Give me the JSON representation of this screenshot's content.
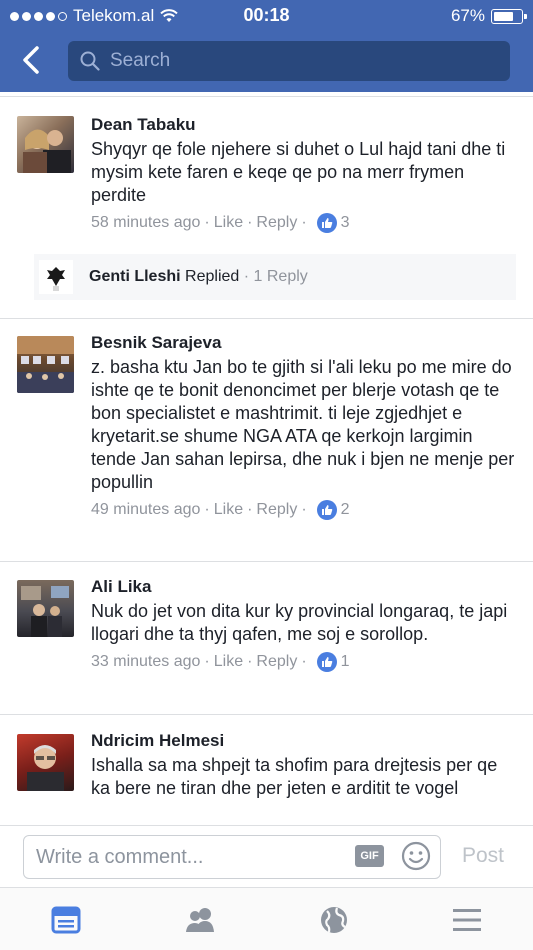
{
  "status_bar": {
    "carrier": "Telekom.al",
    "time": "00:18",
    "battery": "67%"
  },
  "header": {
    "search_placeholder": "Search"
  },
  "comments": [
    {
      "name": "Dean Tabaku",
      "text": "Shyqyr qe fole njehere si duhet o Lul hajd tani dhe ti mysim kete faren e keqe qe po na merr frymen perdite",
      "time": "58 minutes ago",
      "like": "Like",
      "reply": "Reply",
      "likes": "3"
    },
    {
      "name": "Besnik Sarajeva",
      "text": "z. basha ktu Jan bo te gjith si l'ali leku po me mire do ishte qe te bonit denoncimet per blerje votash qe te bon specialistet e mashtrimit. ti leje zgjedhjet e kryetarit.se shume NGA ATA qe kerkojn largimin tende Jan sahan lepirsa, dhe nuk i bjen ne menje per popullin",
      "time": "49 minutes ago",
      "like": "Like",
      "reply": "Reply",
      "likes": "2"
    },
    {
      "name": "Ali Lika",
      "text": "Nuk do jet von dita kur ky provincial longaraq, te japi llogari dhe ta thyj qafen, me soj e sorollop.",
      "time": "33 minutes ago",
      "like": "Like",
      "reply": "Reply",
      "likes": "1"
    },
    {
      "name": "Ndricim Helmesi",
      "text": "Ishalla sa ma shpejt ta shofim  para drejtesis per qe ka bere ne tiran dhe per jeten e arditit te vogel"
    }
  ],
  "reply_summary": {
    "name": "Genti Lleshi",
    "action": "Replied",
    "count": "1 Reply"
  },
  "composer": {
    "placeholder": "Write a comment...",
    "gif_label": "GIF",
    "post_label": "Post"
  },
  "tabbar": {
    "icons": [
      "news-feed-icon",
      "friends-icon",
      "globe-icon",
      "menu-icon"
    ]
  },
  "colors": {
    "header": "#4267b2",
    "search": "#29487d",
    "like_badge": "#4a7ee0",
    "meta": "#90949c"
  }
}
